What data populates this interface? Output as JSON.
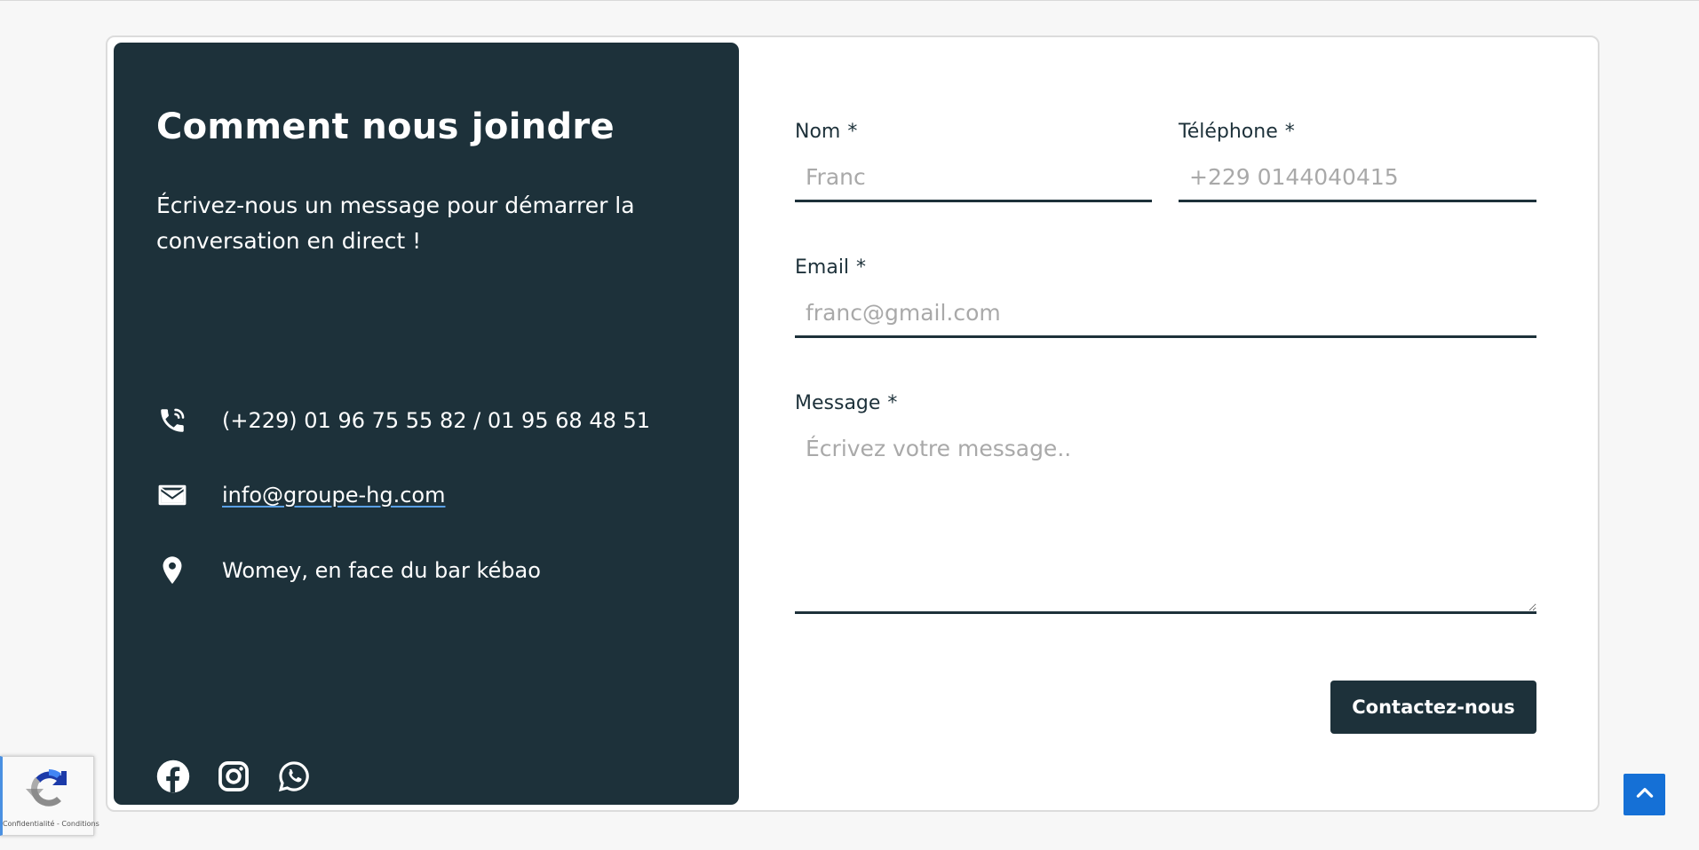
{
  "info": {
    "title": "Comment nous joindre",
    "subtitle": "Écrivez-nous un message pour démarrer la conversation en direct !",
    "phone": "(+229) 01 96 75 55 82 / 01 95 68 48 51",
    "email": "info@groupe-hg.com",
    "address": "Womey, en face du bar kébao",
    "icons": {
      "phone": "phone-icon",
      "email": "envelope-icon",
      "address": "location-pin-icon"
    },
    "socials": [
      "facebook-icon",
      "instagram-icon",
      "whatsapp-icon"
    ]
  },
  "form": {
    "required_mark": "*",
    "name": {
      "label": "Nom",
      "placeholder": "Franc",
      "value": ""
    },
    "phone": {
      "label": "Téléphone",
      "placeholder": "+229 0144040415",
      "value": ""
    },
    "email": {
      "label": "Email",
      "placeholder": "franc@gmail.com",
      "value": ""
    },
    "message": {
      "label": "Message",
      "placeholder": "Écrivez votre message..",
      "value": ""
    },
    "submit_label": "Contactez-nous"
  },
  "recaptcha": {
    "legal": "Confidentialité - Conditions",
    "icon": "recaptcha-logo"
  },
  "scroll_top": {
    "icon": "chevron-up-icon"
  },
  "colors": {
    "panel": "#1d313a",
    "accent": "#1570d6",
    "page_bg": "#f7f7f7",
    "placeholder": "#a9a9a9"
  }
}
